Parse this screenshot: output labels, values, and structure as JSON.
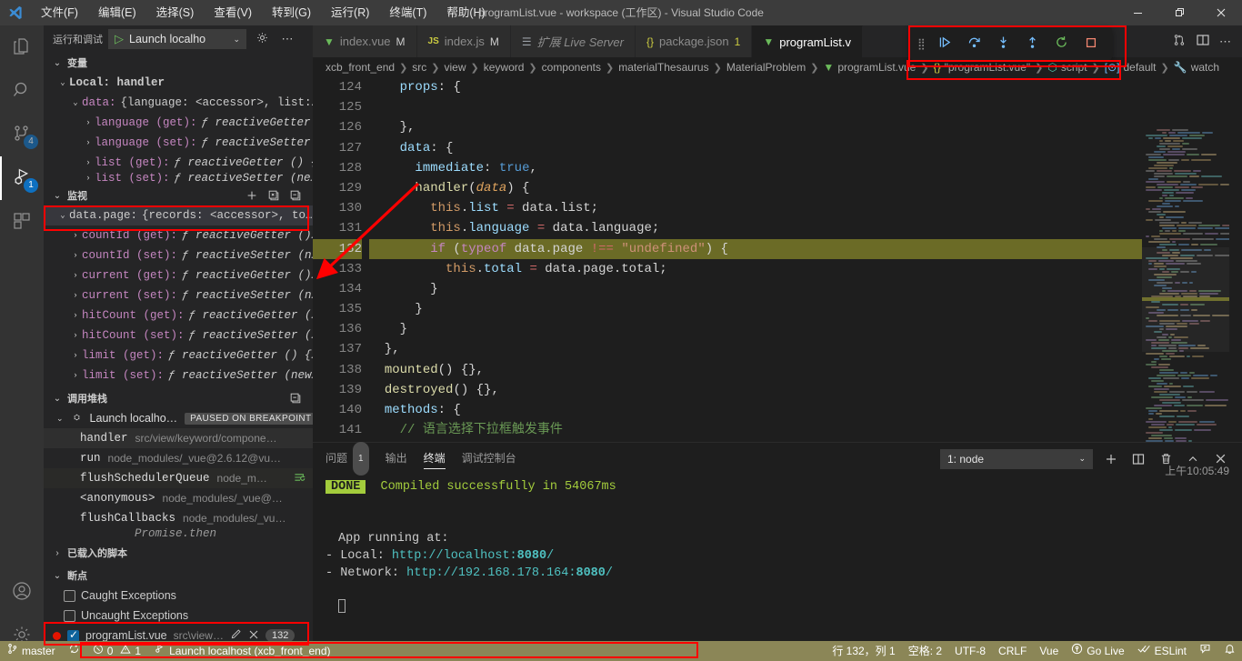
{
  "titlebar": {
    "logo": "vscode-logo",
    "window_title": "programList.vue - workspace (工作区) - Visual Studio Code",
    "menus": [
      "文件(F)",
      "编辑(E)",
      "选择(S)",
      "查看(V)",
      "转到(G)",
      "运行(R)",
      "终端(T)",
      "帮助(H)"
    ],
    "window_buttons": [
      "minimize",
      "restore",
      "close"
    ]
  },
  "activitybar": {
    "items": [
      {
        "name": "explorer",
        "glyph": "files-icon",
        "badge": ""
      },
      {
        "name": "search",
        "glyph": "search-icon",
        "badge": ""
      },
      {
        "name": "source-control",
        "glyph": "source-control-icon",
        "badge": "4"
      },
      {
        "name": "run-and-debug",
        "glyph": "debug-icon",
        "badge": "1",
        "active": true
      },
      {
        "name": "extensions",
        "glyph": "extensions-icon",
        "badge": ""
      }
    ],
    "bottom": [
      {
        "name": "accounts",
        "glyph": "account-icon"
      },
      {
        "name": "manage",
        "glyph": "gear-icon"
      }
    ]
  },
  "sidebar": {
    "title": "运行和调试",
    "launch_config": "Launch localho",
    "start_icon": "play-icon",
    "gear_icon": "gear-icon",
    "more_icon": "ellipsis-icon",
    "variables": {
      "header": "变量",
      "rows": [
        {
          "indent": 1,
          "twisty": "⌄",
          "name": "Local: handler",
          "value": "",
          "mono": true
        },
        {
          "indent": 2,
          "twisty": "⌄",
          "name": "data:",
          "value": "{language: <accessor>, list:…"
        },
        {
          "indent": 3,
          "twisty": "›",
          "name": "language (get):",
          "value": "ƒ reactiveGetter …"
        },
        {
          "indent": 3,
          "twisty": "›",
          "name": "language (set):",
          "value": "ƒ reactiveSetter …"
        },
        {
          "indent": 3,
          "twisty": "›",
          "name": "list (get):",
          "value": "ƒ reactiveGetter () {…"
        },
        {
          "indent": 3,
          "twisty": "›",
          "name": "list (set):",
          "value": "ƒ reactiveSetter (ne…"
        }
      ]
    },
    "watch": {
      "header": "监视",
      "actions": [
        "add-expression-icon",
        "collapse-all-icon",
        "remove-all-icon"
      ],
      "rows": [
        {
          "indent": 1,
          "twisty": "⌄",
          "name": "data.page:",
          "value": "{records: <accessor>, to…",
          "highlighted": true
        },
        {
          "indent": 2,
          "twisty": "›",
          "name": "countId (get):",
          "value": "ƒ reactiveGetter ()…"
        },
        {
          "indent": 2,
          "twisty": "›",
          "name": "countId (set):",
          "value": "ƒ reactiveSetter (n…"
        },
        {
          "indent": 2,
          "twisty": "›",
          "name": "current (get):",
          "value": "ƒ reactiveGetter ()…"
        },
        {
          "indent": 2,
          "twisty": "›",
          "name": "current (set):",
          "value": "ƒ reactiveSetter (n…"
        },
        {
          "indent": 2,
          "twisty": "›",
          "name": "hitCount (get):",
          "value": "ƒ reactiveGetter (…"
        },
        {
          "indent": 2,
          "twisty": "›",
          "name": "hitCount (set):",
          "value": "ƒ reactiveSetter (…"
        },
        {
          "indent": 2,
          "twisty": "›",
          "name": "limit (get):",
          "value": "ƒ reactiveGetter () {…"
        },
        {
          "indent": 2,
          "twisty": "›",
          "name": "limit (set):",
          "value": "ƒ reactiveSetter (new…"
        }
      ]
    },
    "callstack": {
      "header": "调用堆栈",
      "action": "collapse-all-icon",
      "session": {
        "name": "Launch localho…",
        "status": "PAUSED ON BREAKPOINT"
      },
      "frames": [
        {
          "fn": "handler",
          "src": "src/view/keyword/compone…",
          "current": true
        },
        {
          "fn": "run",
          "src": "node_modules/_vue@2.6.12@vu…"
        },
        {
          "fn": "flushSchedulerQueue",
          "src": "node_m…",
          "badge": "restart-frame-icon"
        },
        {
          "fn": "<anonymous>",
          "src": "node_modules/_vue@…"
        },
        {
          "fn": "flushCallbacks",
          "src": "node_modules/_vu…"
        },
        {
          "fn": "Promise.then",
          "src": "",
          "async": true
        }
      ]
    },
    "loaded_scripts": {
      "header": "已载入的脚本"
    },
    "breakpoints": {
      "header": "断点",
      "items": [
        {
          "type": "exception",
          "checked": false,
          "label": "Caught Exceptions"
        },
        {
          "type": "exception",
          "checked": false,
          "label": "Uncaught Exceptions"
        },
        {
          "type": "file",
          "checked": true,
          "label": "programList.vue",
          "path": "src\\view…",
          "line": "132",
          "edit_icon": "pencil-icon",
          "remove_icon": "close-icon",
          "highlighted": true
        }
      ]
    }
  },
  "editor": {
    "tabs": [
      {
        "icon": "vue-icon",
        "label": "index.vue",
        "badge": "M",
        "active": false
      },
      {
        "icon": "js-icon",
        "label": "index.js",
        "badge": "M",
        "active": false
      },
      {
        "icon": "md-icon",
        "label": "扩展 Live Server",
        "badge": "",
        "active": false,
        "italic": true
      },
      {
        "icon": "json-icon",
        "label": "package.json",
        "badge": "1",
        "active": false
      },
      {
        "icon": "vue-icon",
        "label": "programList.v",
        "badge": "",
        "active": true
      }
    ],
    "tab_actions": [
      "split-editor-icon",
      "more-actions-icon"
    ],
    "breadcrumbs": [
      "xcb_front_end",
      "src",
      "view",
      "keyword",
      "components",
      "materialThesaurus",
      "MaterialProblem",
      "programList.vue",
      "\"programList.vue\"",
      "script",
      "default",
      "watch"
    ],
    "first_line": 124,
    "highlight_line": 132,
    "breakpoint_line": 132,
    "lines": [
      {
        "n": 124,
        "tokens": [
          {
            "t": "plain",
            "s": "    "
          },
          {
            "t": "prop",
            "s": "props"
          },
          {
            "t": "plain",
            "s": ": {"
          }
        ]
      },
      {
        "n": 125,
        "tokens": [
          {
            "t": "plain",
            "s": ""
          }
        ]
      },
      {
        "n": 126,
        "tokens": [
          {
            "t": "plain",
            "s": "    },"
          }
        ]
      },
      {
        "n": 127,
        "tokens": [
          {
            "t": "plain",
            "s": "    "
          },
          {
            "t": "prop",
            "s": "data"
          },
          {
            "t": "plain",
            "s": ": {"
          }
        ]
      },
      {
        "n": 128,
        "tokens": [
          {
            "t": "plain",
            "s": "      "
          },
          {
            "t": "prop",
            "s": "immediate"
          },
          {
            "t": "plain",
            "s": ": "
          },
          {
            "t": "kwblue",
            "s": "true"
          },
          {
            "t": "plain",
            "s": ","
          }
        ]
      },
      {
        "n": 129,
        "tokens": [
          {
            "t": "plain",
            "s": "      "
          },
          {
            "t": "fn",
            "s": "handler"
          },
          {
            "t": "plain",
            "s": "("
          },
          {
            "t": "param",
            "s": "data"
          },
          {
            "t": "plain",
            "s": ") {"
          }
        ]
      },
      {
        "n": 130,
        "tokens": [
          {
            "t": "plain",
            "s": "        "
          },
          {
            "t": "this",
            "s": "this"
          },
          {
            "t": "plain",
            "s": "."
          },
          {
            "t": "prop",
            "s": "list"
          },
          {
            "t": "plain",
            "s": " "
          },
          {
            "t": "eq",
            "s": "="
          },
          {
            "t": "plain",
            "s": " data.list;"
          }
        ]
      },
      {
        "n": 131,
        "tokens": [
          {
            "t": "plain",
            "s": "        "
          },
          {
            "t": "this",
            "s": "this"
          },
          {
            "t": "plain",
            "s": "."
          },
          {
            "t": "prop",
            "s": "language"
          },
          {
            "t": "plain",
            "s": " "
          },
          {
            "t": "eq",
            "s": "="
          },
          {
            "t": "plain",
            "s": " data.language;"
          }
        ]
      },
      {
        "n": 132,
        "tokens": [
          {
            "t": "plain",
            "s": "        "
          },
          {
            "t": "key",
            "s": "if"
          },
          {
            "t": "plain",
            "s": " ("
          },
          {
            "t": "key",
            "s": "typeof"
          },
          {
            "t": "plain",
            "s": " data.page "
          },
          {
            "t": "eq",
            "s": "!=="
          },
          {
            "t": "plain",
            "s": " "
          },
          {
            "t": "str",
            "s": "\"undefined\""
          },
          {
            "t": "plain",
            "s": ") {"
          }
        ]
      },
      {
        "n": 133,
        "tokens": [
          {
            "t": "plain",
            "s": "          "
          },
          {
            "t": "this",
            "s": "this"
          },
          {
            "t": "plain",
            "s": "."
          },
          {
            "t": "prop",
            "s": "total"
          },
          {
            "t": "plain",
            "s": " "
          },
          {
            "t": "eq",
            "s": "="
          },
          {
            "t": "plain",
            "s": " data.page.total;"
          }
        ]
      },
      {
        "n": 134,
        "tokens": [
          {
            "t": "plain",
            "s": "        }"
          }
        ]
      },
      {
        "n": 135,
        "tokens": [
          {
            "t": "plain",
            "s": "      }"
          }
        ]
      },
      {
        "n": 136,
        "tokens": [
          {
            "t": "plain",
            "s": "    }"
          }
        ]
      },
      {
        "n": 137,
        "tokens": [
          {
            "t": "plain",
            "s": "  },"
          }
        ]
      },
      {
        "n": 138,
        "tokens": [
          {
            "t": "plain",
            "s": "  "
          },
          {
            "t": "fn",
            "s": "mounted"
          },
          {
            "t": "plain",
            "s": "() {},"
          }
        ]
      },
      {
        "n": 139,
        "tokens": [
          {
            "t": "plain",
            "s": "  "
          },
          {
            "t": "fn",
            "s": "destroyed"
          },
          {
            "t": "plain",
            "s": "() {},"
          }
        ]
      },
      {
        "n": 140,
        "tokens": [
          {
            "t": "plain",
            "s": "  "
          },
          {
            "t": "prop",
            "s": "methods"
          },
          {
            "t": "plain",
            "s": ": {"
          }
        ]
      },
      {
        "n": 141,
        "tokens": [
          {
            "t": "plain",
            "s": "    "
          },
          {
            "t": "cmt",
            "s": "// 语言选择下拉框触发事件"
          }
        ]
      }
    ]
  },
  "panel": {
    "tabs": [
      {
        "label": "问题",
        "badge": "1",
        "active": false
      },
      {
        "label": "输出",
        "badge": "",
        "active": false
      },
      {
        "label": "终端",
        "badge": "",
        "active": true
      },
      {
        "label": "调试控制台",
        "badge": "",
        "active": false
      }
    ],
    "terminal_select": "1: node",
    "actions": [
      "new-terminal-icon",
      "split-terminal-icon",
      "kill-terminal-icon",
      "maximize-panel-icon",
      "close-panel-icon"
    ],
    "timestamp": "上午10:05:49",
    "output": {
      "done_badge": "DONE",
      "compiled": "Compiled successfully in 54067ms",
      "app_running": "App running at:",
      "local_label": "  - Local:   ",
      "local_url_prefix": "http://localhost:",
      "local_port": "8080",
      "local_suffix": "/",
      "network_label": "  - Network: ",
      "network_url_prefix": "http://192.168.178.164:",
      "network_port": "8080",
      "network_suffix": "/"
    }
  },
  "debug_toolbar": {
    "grip": "drag-handle",
    "buttons": [
      {
        "name": "continue",
        "glyph": "continue-icon"
      },
      {
        "name": "step-over",
        "glyph": "step-over-icon"
      },
      {
        "name": "step-into",
        "glyph": "step-into-icon"
      },
      {
        "name": "step-out",
        "glyph": "step-out-icon"
      },
      {
        "name": "restart",
        "glyph": "restart-icon"
      },
      {
        "name": "stop",
        "glyph": "stop-icon"
      }
    ]
  },
  "statusbar": {
    "branch": "master",
    "sync_icon": "sync-icon",
    "errors": "0",
    "warnings": "1",
    "debug_session": "Launch localhost (xcb_front_end)",
    "cursor": "行 132，列 1",
    "spaces": "空格: 2",
    "encoding": "UTF-8",
    "eol": "CRLF",
    "language": "Vue",
    "golive": "Go Live",
    "eslint": "ESLint",
    "feedback_icon": "feedback-icon",
    "bell_icon": "bell-icon"
  },
  "colors": {
    "accent": "#0e70c0",
    "status_debug_bg": "#8b8657",
    "highlight_line": "#6b6b26",
    "annotation": "#ff0000",
    "done_badge": "#a3cc3c"
  }
}
